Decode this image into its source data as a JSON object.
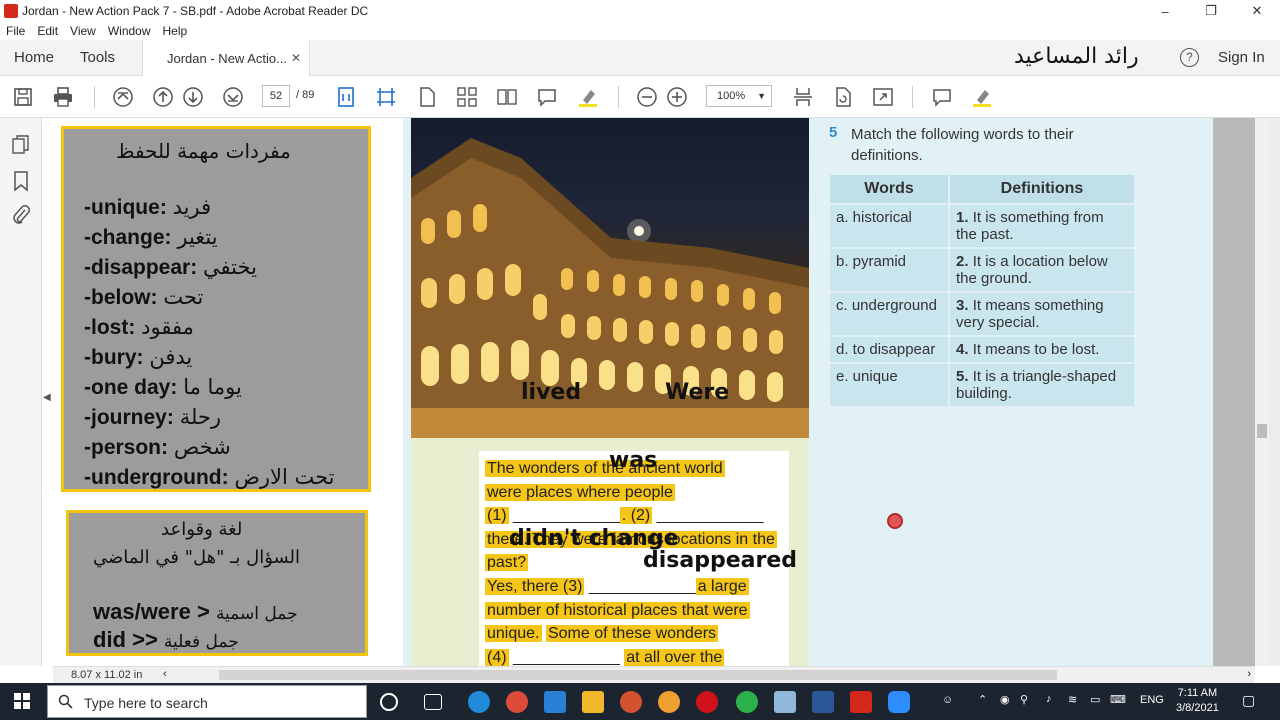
{
  "window": {
    "title": "Jordan - New Action Pack 7 - SB.pdf - Adobe Acrobat Reader DC",
    "minimize": "–",
    "maximize": "❐",
    "close": "✕"
  },
  "menu": [
    "File",
    "Edit",
    "View",
    "Window",
    "Help"
  ],
  "tabs": {
    "home": "Home",
    "tools": "Tools",
    "document": "Jordan - New Actio...",
    "close": "✕"
  },
  "user": {
    "name": "رائد المساعيد",
    "help": "?",
    "signin": "Sign In"
  },
  "toolbar": {
    "page_current": "52",
    "page_total": "/  89",
    "zoom": "100%"
  },
  "vocab": {
    "heading": "مفردات مهمة للحفظ",
    "items": [
      {
        "en": "-unique:",
        "ar": "فريد"
      },
      {
        "en": "-change:",
        "ar": "يتغير"
      },
      {
        "en": "-disappear:",
        "ar": "يختفي"
      },
      {
        "en": "-below:",
        "ar": "تحت"
      },
      {
        "en": "-lost:",
        "ar": "مفقود"
      },
      {
        "en": "-bury:",
        "ar": "يدفن"
      },
      {
        "en": "-one day:",
        "ar": "يوما ما"
      },
      {
        "en": "-journey:",
        "ar": "رحلة"
      },
      {
        "en": "-person:",
        "ar": "شخص"
      },
      {
        "en": "-underground:",
        "ar": "تحت الارض"
      }
    ]
  },
  "grammar": {
    "title": "لغة وقواعد",
    "subtitle": "السؤال بـ \"هل\" في الماضي",
    "line1_en": "was/were >",
    "line1_ar": "جمل اسمية",
    "line2_en": "did >>",
    "line2_ar": "جمل فعلية"
  },
  "handwritten": {
    "lived": "lived",
    "were": "Were",
    "was": "was",
    "didnt_change": "didn't change",
    "disappeared": "disappeared"
  },
  "paragraph": {
    "l1": "The wonders of the ancient world",
    "l2": "were places where people",
    "l3a": "(1)",
    "l3b": ". (2)",
    "l4": "there. They were famous locations in the",
    "l5": "past?",
    "l6a": "Yes, there (3)",
    "l6b": "a large",
    "l7": "number of historical places that were",
    "l8a": "unique.",
    "l8b": "Some of these wonders",
    "l9a": "(4)",
    "l9b": "at all over the"
  },
  "exercise": {
    "number": "5",
    "instruction": "Match the following words to their definitions.",
    "col_words": "Words",
    "col_definitions": "Definitions",
    "rows": [
      {
        "word": "a. historical",
        "num": "1.",
        "def": "It is something from the past."
      },
      {
        "word": "b. pyramid",
        "num": "2.",
        "def": "It is a location below the ground."
      },
      {
        "word": "c. underground",
        "num": "3.",
        "def": "It means something very special."
      },
      {
        "word": "d. to disappear",
        "num": "4.",
        "def": "It means to be lost."
      },
      {
        "word": "e. unique",
        "num": "5.",
        "def": "It is a triangle-shaped building."
      }
    ]
  },
  "status": {
    "page_size": "8.07 x 11.02 in"
  },
  "taskbar": {
    "search_placeholder": "Type here to search",
    "lang": "ENG",
    "time": "7:11 AM",
    "date": "3/8/2021"
  },
  "colors": {
    "highlight": "#f5c518",
    "vocab_border": "#f1c40f",
    "accent_blue": "#2a8fcc",
    "acrobat_red": "#d4281c"
  }
}
